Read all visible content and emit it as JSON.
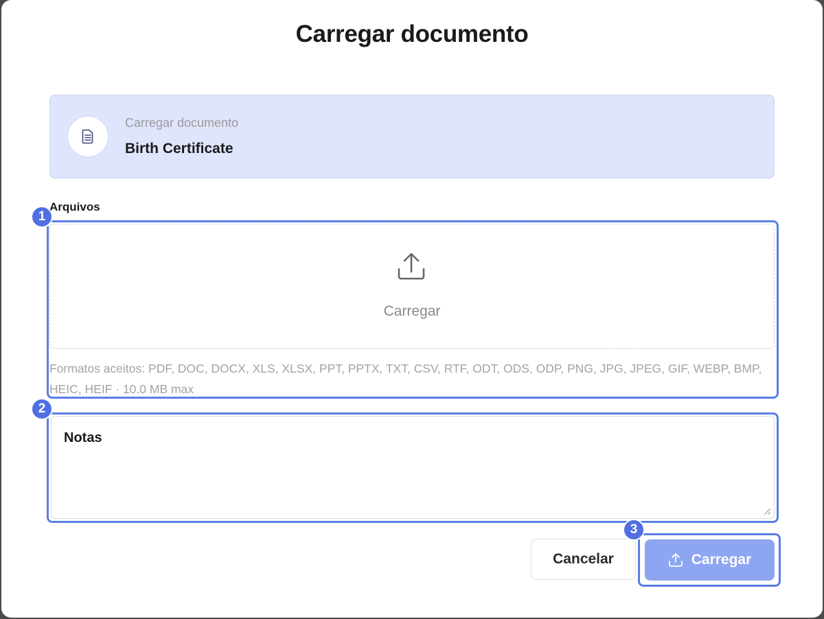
{
  "modal": {
    "title": "Carregar documento"
  },
  "document_card": {
    "label": "Carregar documento",
    "name": "Birth Certificate",
    "icon": "document-icon"
  },
  "files": {
    "label": "Arquivos",
    "dropzone_label": "Carregar",
    "dropzone_icon": "upload-icon",
    "formats_text": "Formatos aceitos: PDF, DOC, DOCX, XLS, XLSX, PPT, PPTX, TXT, CSV, RTF, ODT, ODS, ODP, PNG, JPG, JPEG, GIF, WEBP, BMP, HEIC, HEIF · 10.0 MB max"
  },
  "notes": {
    "label": "Notas"
  },
  "actions": {
    "cancel_label": "Cancelar",
    "upload_label": "Carregar"
  },
  "annotations": [
    "1",
    "2",
    "3"
  ],
  "colors": {
    "accent": "#4f6fe2",
    "card_bg": "#dfe5fc",
    "upload_button": "#8ea6f2"
  }
}
